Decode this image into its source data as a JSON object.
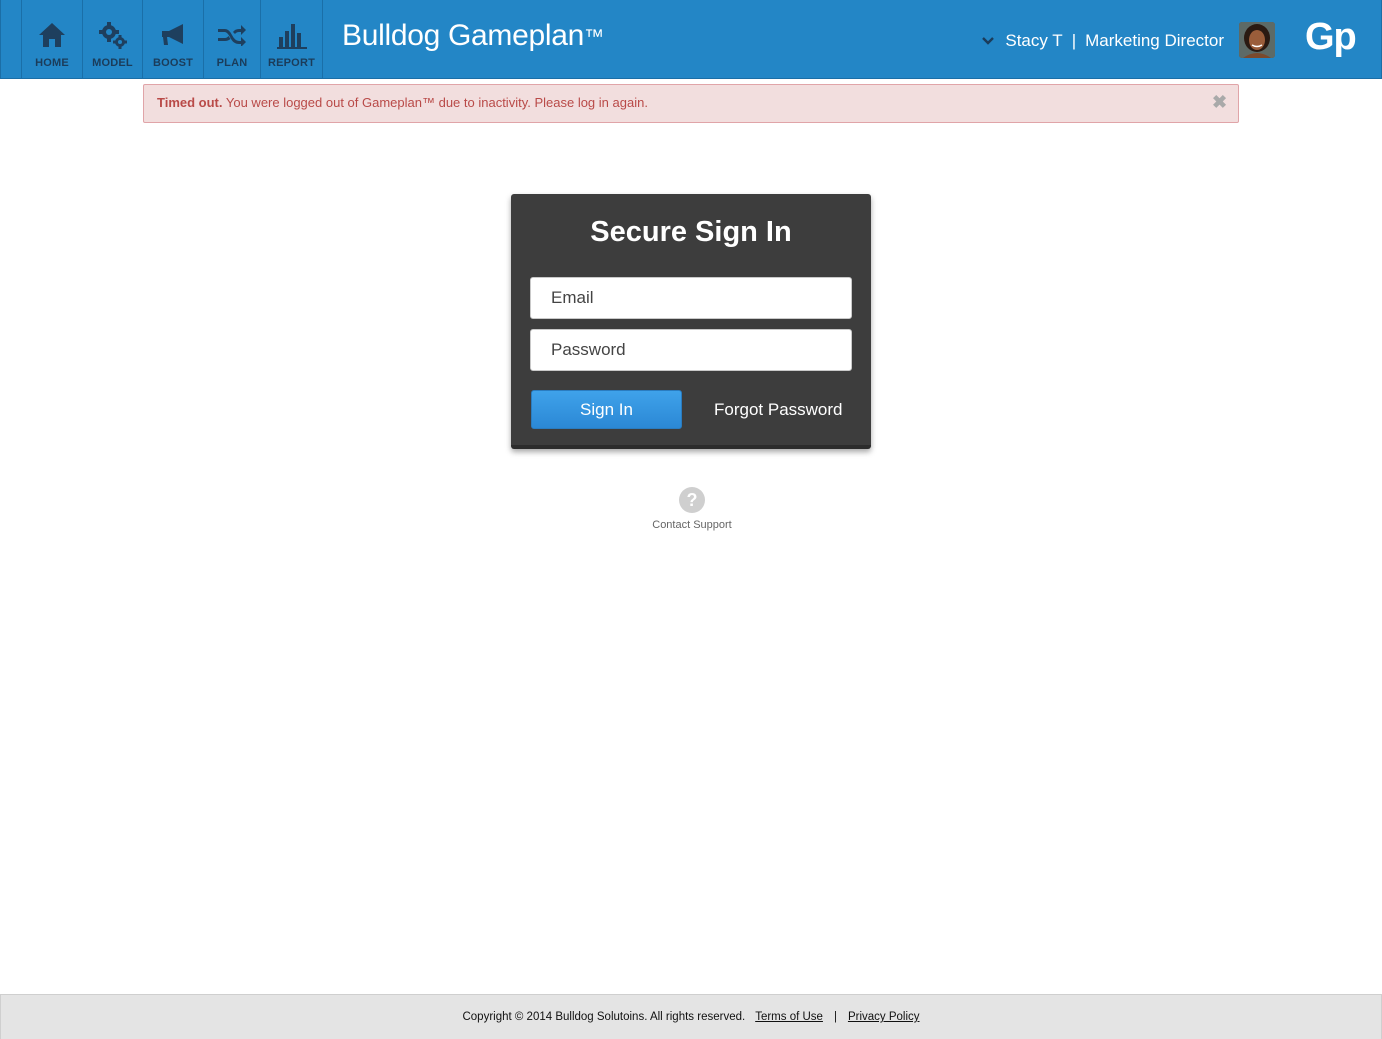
{
  "header": {
    "nav": [
      {
        "label": "HOME",
        "icon": "home-icon"
      },
      {
        "label": "MODEL",
        "icon": "gears-icon"
      },
      {
        "label": "BOOST",
        "icon": "megaphone-icon"
      },
      {
        "label": "PLAN",
        "icon": "shuffle-icon"
      },
      {
        "label": "REPORT",
        "icon": "bar-chart-icon"
      }
    ],
    "brand": "Bulldog Gameplan",
    "brand_mark": "™",
    "user_name": "Stacy T",
    "user_separator": "|",
    "user_role": "Marketing Director",
    "logo": "Gp"
  },
  "alert": {
    "title": "Timed out.",
    "message": "You were logged out of Gameplan™ due to inactivity. Please log in again.",
    "close_icon": "close-icon"
  },
  "signin": {
    "heading": "Secure Sign In",
    "email_placeholder": "Email",
    "password_placeholder": "Password",
    "submit_label": "Sign In",
    "forgot_label": "Forgot Password"
  },
  "support": {
    "icon_glyph": "?",
    "label": "Contact Support"
  },
  "footer": {
    "copyright": "Copyright © 2014 Bulldog Solutoins. All rights reserved.",
    "terms": "Terms of Use",
    "separator": "|",
    "privacy": "Privacy Policy"
  },
  "colors": {
    "header_bg": "#2386c6",
    "nav_icon": "#1e3f5e",
    "alert_bg": "#f2dede",
    "alert_text": "#b94a48",
    "panel_bg": "#3d3d3d",
    "button_blue": "#2b88d5",
    "footer_bg": "#e4e4e4"
  }
}
